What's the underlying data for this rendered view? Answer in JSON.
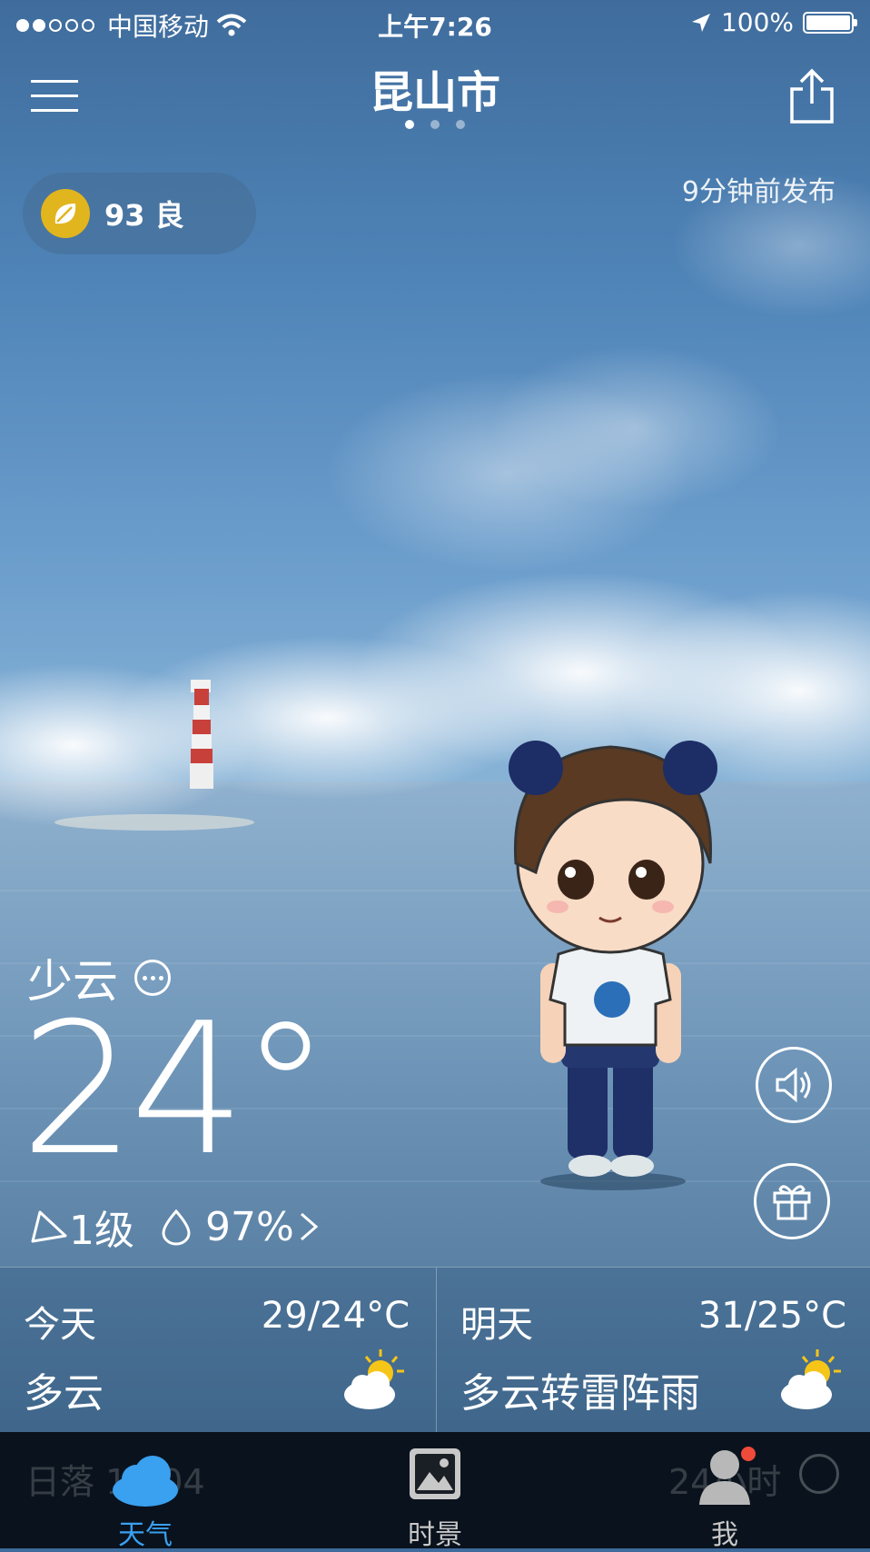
{
  "status_bar": {
    "carrier": "中国移动",
    "time": "上午7:26",
    "battery": "100%"
  },
  "header": {
    "city": "昆山市",
    "page_count": 3,
    "active_page": 1
  },
  "aqi": {
    "value": "93",
    "level": "良"
  },
  "published": "9分钟前发布",
  "current": {
    "condition": "少云",
    "temperature": "24°",
    "wind": "1级",
    "humidity": "97%"
  },
  "forecast": [
    {
      "day": "今天",
      "range": "29/24°C",
      "condition": "多云",
      "icon": "partly-cloudy-icon"
    },
    {
      "day": "明天",
      "range": "31/25°C",
      "condition": "多云转雷阵雨",
      "icon": "partly-cloudy-icon"
    }
  ],
  "hidden_row": {
    "left": "日落 19:04",
    "right": "24小时"
  },
  "tabs": [
    {
      "label": "天气",
      "icon": "cloud-icon",
      "active": true,
      "color": "#3aa0f0"
    },
    {
      "label": "时景",
      "icon": "photo-icon",
      "active": false,
      "color": "#c8c8c8"
    },
    {
      "label": "我",
      "icon": "user-icon",
      "active": false,
      "color": "#c8c8c8",
      "badge": true
    }
  ]
}
